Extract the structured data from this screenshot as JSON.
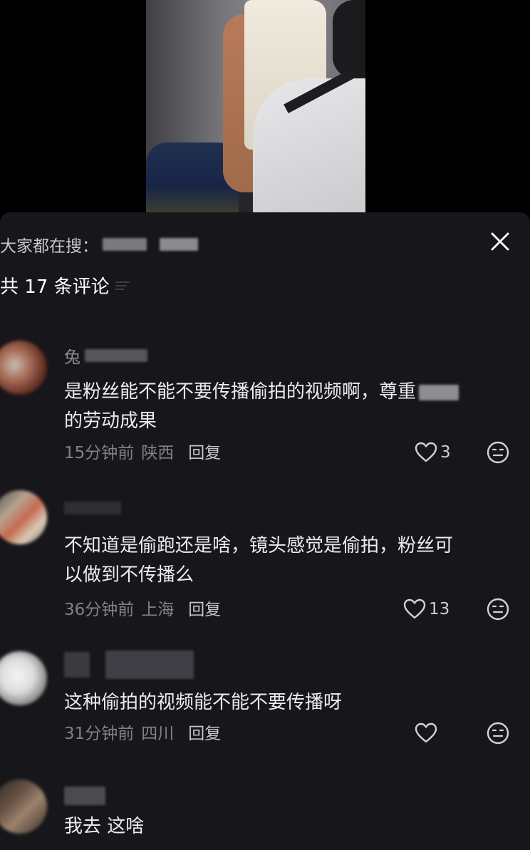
{
  "panel": {
    "search_prefix": "大家都在搜：",
    "comment_count_title": "共 17 条评论"
  },
  "comments": [
    {
      "username": "兔",
      "text": "是粉丝能不能不要传播偷拍的视频啊，尊重",
      "text_line2": "的劳动成果",
      "time": "15分钟前",
      "location": "陕西",
      "reply": "回复",
      "likes": "3"
    },
    {
      "username": "",
      "text": "不知道是偷跑还是啥，镜头感觉是偷拍，粉丝可",
      "text_line2": "以做到不传播么",
      "time": "36分钟前",
      "location": "上海",
      "reply": "回复",
      "likes": "13"
    },
    {
      "username": "",
      "text": "这种偷拍的视频能不能不要传播呀",
      "text_line2": "",
      "time": "31分钟前",
      "location": "四川",
      "reply": "回复",
      "likes": ""
    },
    {
      "username": "",
      "text": "我去 这啥",
      "text_line2": "",
      "time": "",
      "location": "",
      "reply": "",
      "likes": ""
    }
  ],
  "icons": {
    "close": "close-icon",
    "sort": "sort-icon",
    "like": "heart-icon",
    "dislike": "meh-face-icon"
  },
  "colors": {
    "panel_bg": "#17171b",
    "text_primary": "#ececef",
    "text_secondary": "#808087"
  }
}
